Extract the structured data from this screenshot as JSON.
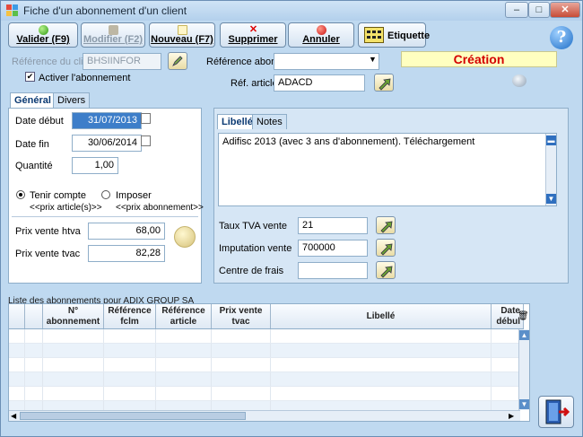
{
  "window": {
    "title": "Fiche d'un abonnement d'un client"
  },
  "toolbar": {
    "validate": "Valider (F9)",
    "modify": "Modifier (F2)",
    "new": "Nouveau (F7)",
    "delete": "Supprimer",
    "cancel": "Annuler",
    "label": "Etiquette"
  },
  "header": {
    "client_ref_label": "Référence du client",
    "client_ref_value": "BHSIINFOR",
    "activate_label": "Activer l'abonnement",
    "subscription_ref_label": "Référence abonne",
    "subscription_ref_value": "",
    "mode_label": "Création",
    "article_ref_label": "Réf. article",
    "article_ref_value": "ADACD"
  },
  "tabs": [
    "Général",
    "Divers"
  ],
  "general": {
    "start_date_label": "Date début",
    "start_date_value": "31/07/2013",
    "end_date_label": "Date fin",
    "end_date_value": "30/06/2014",
    "quantity_label": "Quantité",
    "quantity_value": "1,00",
    "radio1_label": "Tenir compte",
    "radio1_sub": "<<prix article(s)>>",
    "radio2_label": "Imposer",
    "radio2_sub": "<<prix abonnement>>",
    "price_htva_label": "Prix vente htva",
    "price_htva_value": "68,00",
    "price_tvac_label": "Prix vente tvac",
    "price_tvac_value": "82,28"
  },
  "right_tabs": [
    "Libellé",
    "Notes"
  ],
  "label_text": "Adifisc 2013 (avec 3 ans d'abonnement). Téléchargement",
  "right_fields": {
    "vat_label": "Taux TVA vente",
    "vat_value": "21",
    "imputation_label": "Imputation vente",
    "imputation_value": "700000",
    "cost_center_label": "Centre de frais",
    "cost_center_value": ""
  },
  "grid": {
    "title": "Liste des abonnements pour ADIX GROUP SA",
    "columns": [
      [
        "",
        ""
      ],
      [
        "",
        ""
      ],
      [
        "N°",
        "abonnement"
      ],
      [
        "Référence",
        "fclm"
      ],
      [
        "Référence",
        "article"
      ],
      [
        "Prix vente",
        "tvac"
      ],
      [
        "Libellé",
        ""
      ],
      [
        "Date",
        "débul"
      ]
    ]
  },
  "colors": {
    "accent": "#3d7ec9",
    "creation": "#d40000",
    "window": "#bfd9f0"
  }
}
